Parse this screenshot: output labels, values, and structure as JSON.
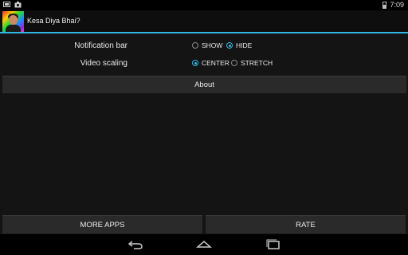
{
  "status_bar": {
    "time": "7:09",
    "left_icons": [
      "screenshot-icon",
      "photo-icon"
    ],
    "right_icons": [
      "battery-icon"
    ]
  },
  "app": {
    "title": "Kesa Diya Bhai?",
    "icon": "app-icon"
  },
  "settings": {
    "notification_bar": {
      "label": "Notification bar",
      "options": [
        "SHOW",
        "HIDE"
      ],
      "selected": "HIDE"
    },
    "video_scaling": {
      "label": "Video scaling",
      "options": [
        "CENTER",
        "STRETCH"
      ],
      "selected": "CENTER"
    }
  },
  "buttons": {
    "about": "About",
    "more_apps": "MORE APPS",
    "rate": "RATE"
  },
  "nav_bar": {
    "icons": [
      "back-icon",
      "home-icon",
      "recents-icon"
    ]
  },
  "colors": {
    "accent": "#33b5e5",
    "background": "#141414",
    "button": "#2a2a2a"
  }
}
